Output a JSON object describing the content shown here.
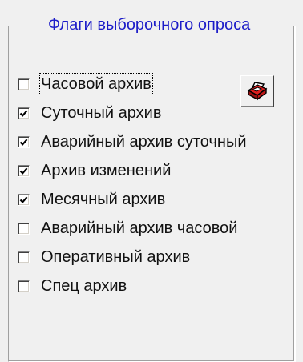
{
  "group": {
    "title": "Флаги выборочного опроса"
  },
  "checkboxes": [
    {
      "label": "Часовой архив",
      "checked": false
    },
    {
      "label": "Суточный архив",
      "checked": true
    },
    {
      "label": "Аварийный архив суточный",
      "checked": true
    },
    {
      "label": "Архив изменений",
      "checked": true
    },
    {
      "label": "Месячный архив",
      "checked": true
    },
    {
      "label": "Аварийный архив часовой",
      "checked": false
    },
    {
      "label": "Оперативный архив",
      "checked": false
    },
    {
      "label": "Спец архив",
      "checked": false
    }
  ],
  "print_button": {
    "icon": "printer-icon"
  },
  "colors": {
    "title": "#1c1cc8",
    "background": "#f0f0f0",
    "print_red": "#d81818"
  }
}
